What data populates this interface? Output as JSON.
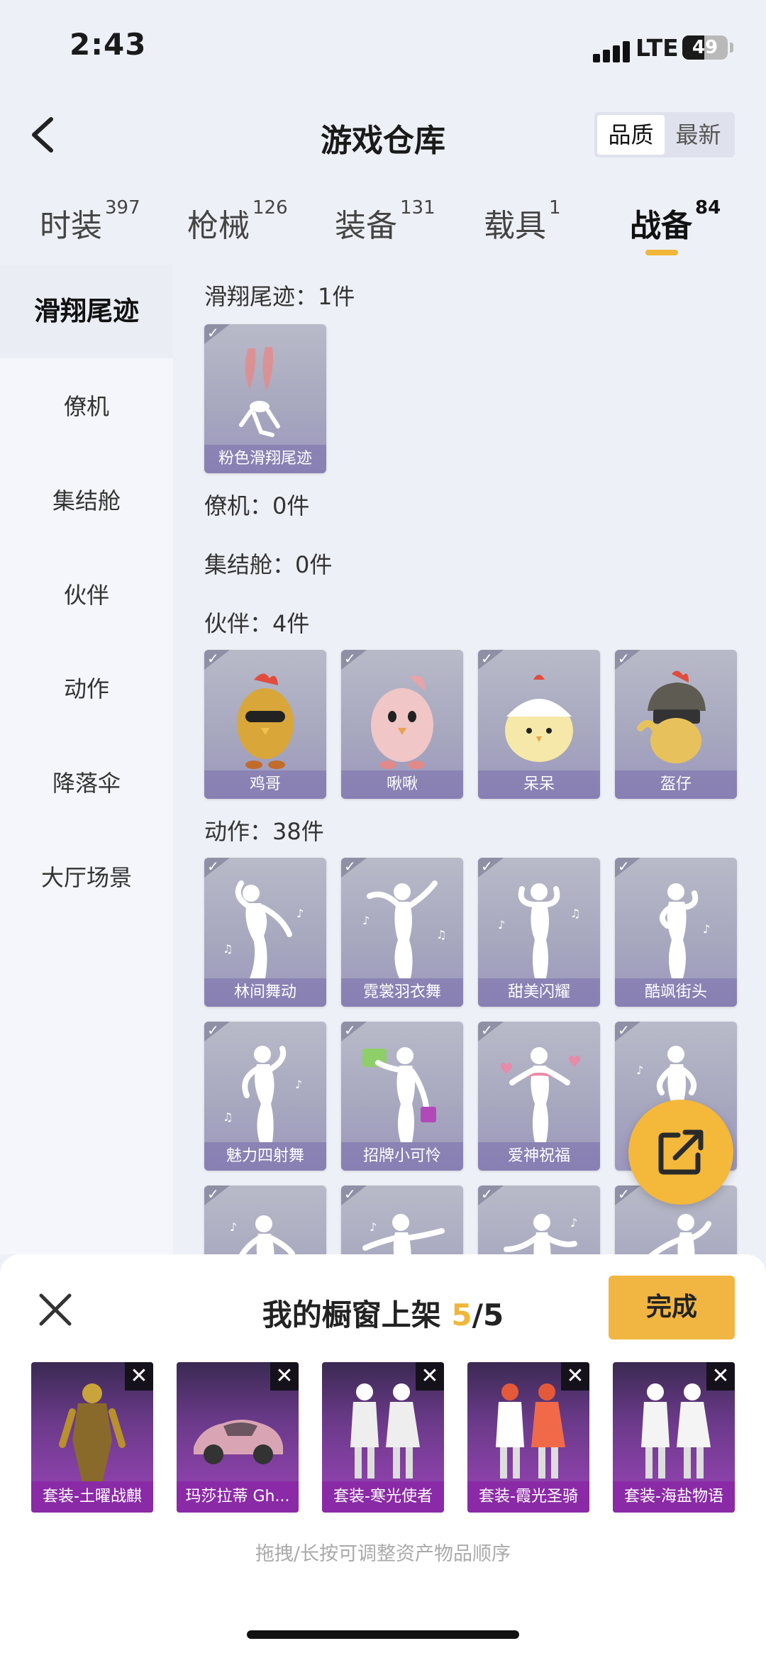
{
  "status": {
    "time": "2:43",
    "network": "LTE",
    "battery": "49",
    "battery_level": 0.49
  },
  "header": {
    "title": "游戏仓库",
    "sort": [
      "品质",
      "最新"
    ]
  },
  "tabs": [
    {
      "label": "时装",
      "count": "397"
    },
    {
      "label": "枪械",
      "count": "126"
    },
    {
      "label": "装备",
      "count": "131"
    },
    {
      "label": "载具",
      "count": "1"
    },
    {
      "label": "战备",
      "count": "84"
    }
  ],
  "sidebar": [
    "滑翔尾迹",
    "僚机",
    "集结舱",
    "伙伴",
    "动作",
    "降落伞",
    "大厅场景"
  ],
  "sections": {
    "glide": {
      "label": "滑翔尾迹：1件",
      "items": [
        "粉色滑翔尾迹"
      ]
    },
    "wingman": {
      "label": "僚机：0件"
    },
    "pod": {
      "label": "集结舱：0件"
    },
    "partner": {
      "label": "伙伴：4件",
      "items": [
        "鸡哥",
        "啾啾",
        "呆呆",
        "盔仔"
      ]
    },
    "emote": {
      "label": "动作：38件",
      "items": [
        "林间舞动",
        "霓裳羽衣舞",
        "甜美闪耀",
        "酷飒街头",
        "魅力四射舞",
        "招牌小可怜",
        "爱神祝福"
      ]
    }
  },
  "shelf": {
    "title_prefix": "我的橱窗上架",
    "current": "5",
    "slash_total": "/5",
    "done": "完成",
    "items": [
      "套装-土曜战麒",
      "玛莎拉蒂 Gh...",
      "套装-寒光使者",
      "套装-霞光圣骑",
      "套装-海盐物语"
    ],
    "hint": "拖拽/长按可调整资产物品顺序"
  }
}
